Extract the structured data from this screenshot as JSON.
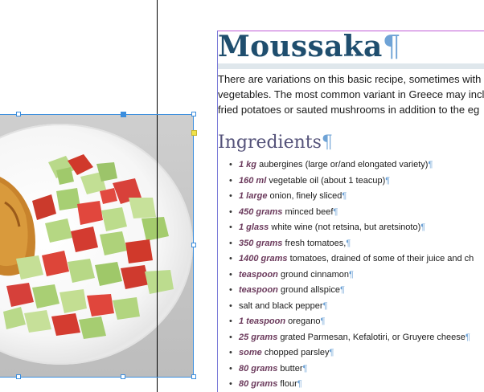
{
  "document": {
    "title": "Moussaka",
    "intro_lines": [
      "There are variations on this basic recipe, sometimes with",
      "vegetables. The most common variant in Greece may incl",
      "fried potatoes or sauted mushrooms in addition to the eg"
    ],
    "section_heading": "Ingredients",
    "pilcrow": "¶",
    "ingredients": [
      {
        "qty": "1 kg",
        "text": "aubergines (large or/and elongated variety)"
      },
      {
        "qty": "160 ml",
        "text": "vegetable oil (about 1 teacup)"
      },
      {
        "qty": "1 large",
        "text": "onion, finely sliced"
      },
      {
        "qty": "450 grams",
        "text": "minced beef"
      },
      {
        "qty": "1 glass",
        "text": "white wine (not retsina, but aretsinoto)"
      },
      {
        "qty": "350 grams",
        "text": "fresh tomatoes,"
      },
      {
        "qty": "1400 grams",
        "text": "tomatoes, drained of some of their juice and ch"
      },
      {
        "qty": "teaspoon",
        "text": "ground cinnamon"
      },
      {
        "qty": "teaspoon",
        "text": "ground allspice"
      },
      {
        "qty": "",
        "text": "salt and black pepper"
      },
      {
        "qty": "1 teaspoon",
        "text": "oregano"
      },
      {
        "qty": "25 grams",
        "text": "grated Parmesan, Kefalotiri, or Gruyere cheese"
      },
      {
        "qty": "some",
        "text": "chopped parsley"
      },
      {
        "qty": "80 grams",
        "text": "butter"
      },
      {
        "qty": "80 grams",
        "text": "flour"
      }
    ]
  },
  "colors": {
    "title": "#1f4e6e",
    "heading": "#55537a",
    "quantity": "#6b3a5c",
    "pilcrow": "#6fa3d6",
    "selection": "#3b8ede"
  }
}
